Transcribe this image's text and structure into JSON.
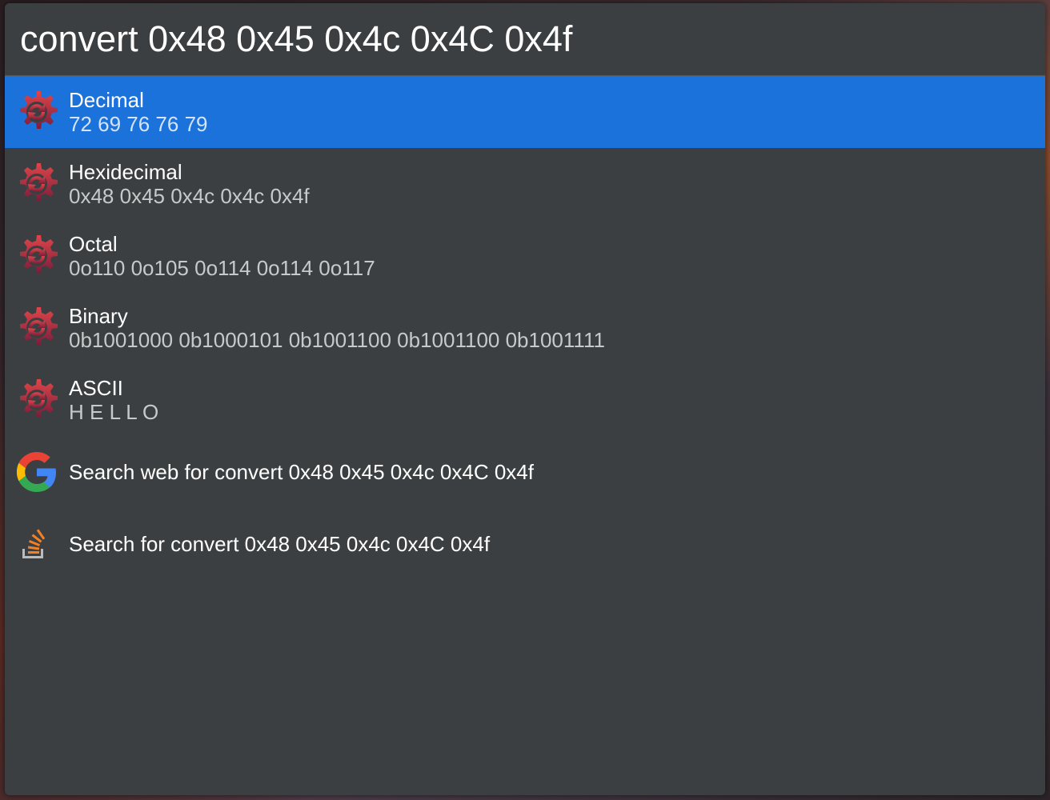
{
  "search": {
    "query": "convert 0x48 0x45 0x4c 0x4C 0x4f"
  },
  "results": [
    {
      "title": "Decimal",
      "subtitle": "72 69 76 76 79",
      "icon": "converter-gear-icon",
      "selected": true
    },
    {
      "title": "Hexidecimal",
      "subtitle": "0x48 0x45 0x4c 0x4c 0x4f",
      "icon": "converter-gear-icon"
    },
    {
      "title": "Octal",
      "subtitle": "0o110 0o105 0o114 0o114 0o117",
      "icon": "converter-gear-icon"
    },
    {
      "title": "Binary",
      "subtitle": "0b1001000 0b1000101 0b1001100 0b1001100 0b1001111",
      "icon": "converter-gear-icon"
    },
    {
      "title": "ASCII",
      "subtitle": "H E L L O",
      "icon": "converter-gear-icon"
    },
    {
      "title": "Search web for convert 0x48 0x45 0x4c 0x4C 0x4f",
      "icon": "google-icon"
    },
    {
      "title": "Search for convert 0x48 0x45 0x4c 0x4C 0x4f",
      "icon": "stackoverflow-icon"
    }
  ],
  "colors": {
    "panel_bg": "#3c3f41",
    "selected_bg": "#1b72da",
    "text": "#ffffff",
    "subtext": "#c7c9cb"
  }
}
